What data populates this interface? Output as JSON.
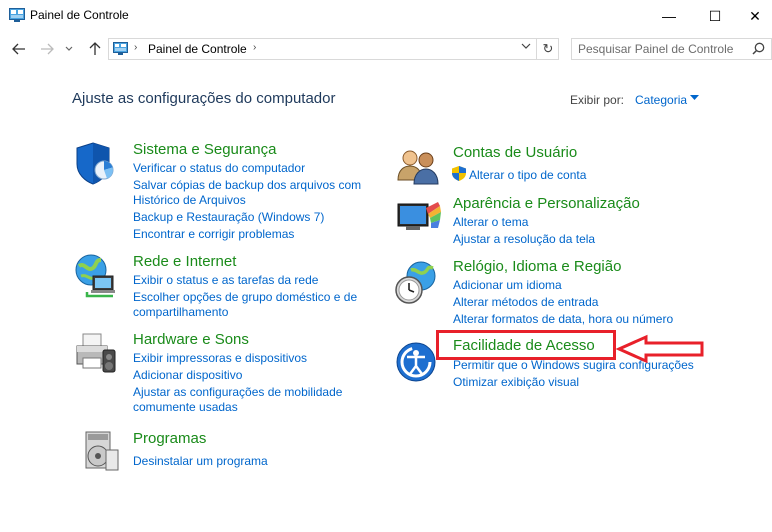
{
  "window": {
    "title": "Painel de Controle",
    "minimize": "—",
    "maximize": "☐",
    "close": "✕"
  },
  "nav": {
    "back_icon": "arrow-left-icon",
    "forward_icon": "arrow-right-icon",
    "recent_icon": "chevron-down-icon",
    "up_icon": "arrow-up-icon"
  },
  "address": {
    "separator": "›",
    "crumb": "Painel de Controle",
    "dropdown": "⌄",
    "refresh": "↻"
  },
  "search": {
    "placeholder": "Pesquisar Painel de Controle",
    "icon": "search-icon"
  },
  "header": {
    "title": "Ajuste as configurações do computador",
    "view_label": "Exibir por:",
    "view_value": "Categoria"
  },
  "categories": {
    "sistema": {
      "title": "Sistema e Segurança",
      "links": [
        "Verificar o status do computador",
        "Salvar cópias de backup dos arquivos com",
        "Histórico de Arquivos",
        "Backup e Restauração (Windows 7)",
        "Encontrar e corrigir problemas"
      ]
    },
    "rede": {
      "title": "Rede e Internet",
      "links": [
        "Exibir o status e as tarefas da rede",
        "Escolher opções de grupo doméstico e de",
        "compartilhamento"
      ]
    },
    "hardware": {
      "title": "Hardware e Sons",
      "links": [
        "Exibir impressoras e dispositivos",
        "Adicionar dispositivo",
        "Ajustar as configurações de mobilidade",
        "comumente usadas"
      ]
    },
    "programas": {
      "title": "Programas",
      "links": [
        "Desinstalar um programa"
      ]
    },
    "contas": {
      "title": "Contas de Usuário",
      "links": [
        "Alterar o tipo de conta"
      ]
    },
    "aparencia": {
      "title": "Aparência e Personalização",
      "links": [
        "Alterar o tema",
        "Ajustar a resolução da tela"
      ]
    },
    "relogio": {
      "title": "Relógio, Idioma e Região",
      "links": [
        "Adicionar um idioma",
        "Alterar métodos de entrada",
        "Alterar formatos de data, hora ou número"
      ]
    },
    "facilidade": {
      "title": "Facilidade de Acesso",
      "links": [
        "Permitir que o Windows sugira configurações",
        "Otimizar exibição visual"
      ]
    }
  },
  "annotation": {
    "color": "#e8202a"
  }
}
